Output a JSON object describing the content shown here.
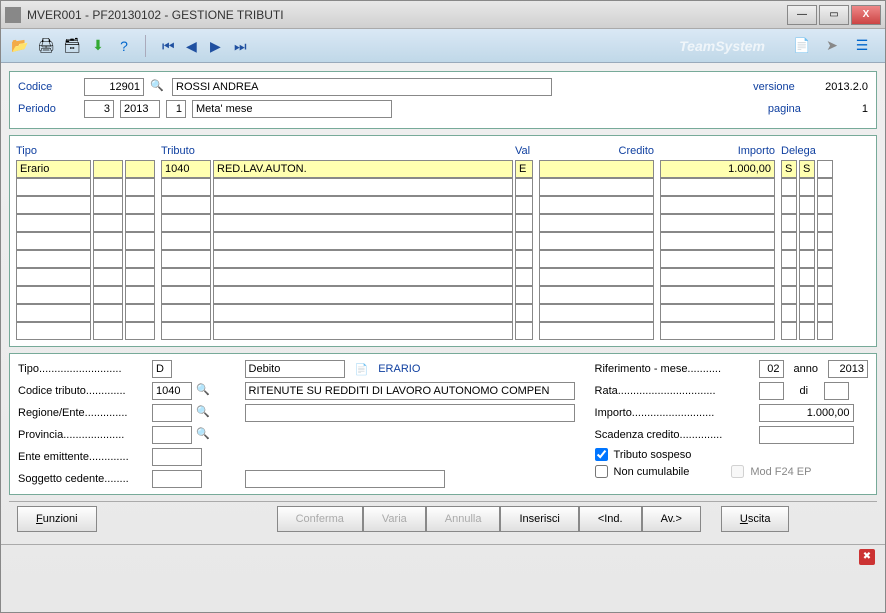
{
  "window": {
    "title": "MVER001  - PF20130102 -  GESTIONE TRIBUTI"
  },
  "brand": "TeamSystem",
  "header": {
    "codice_label": "Codice",
    "codice_value": "12901",
    "codice_name": "ROSSI ANDREA",
    "periodo_label": "Periodo",
    "periodo_month": "3",
    "periodo_year": "2013",
    "periodo_seq": "1",
    "periodo_desc": "Meta' mese",
    "versione_label": "versione",
    "versione_value": "2013.2.0",
    "pagina_label": "pagina",
    "pagina_value": "1"
  },
  "grid": {
    "headers": {
      "tipo": "Tipo",
      "tributo": "Tributo",
      "val": "Val",
      "credito": "Credito",
      "importo": "Importo",
      "delega": "Delega"
    },
    "rows": [
      {
        "tipo": "Erario",
        "tipo2": "",
        "tipo3": "",
        "tributo_code": "1040",
        "tributo_desc": "RED.LAV.AUTON.",
        "val": "E",
        "credito": "",
        "importo": "1.000,00",
        "delega1": "S",
        "delega2": "S",
        "delega3": ""
      },
      {
        "tipo": "",
        "tipo2": "",
        "tipo3": "",
        "tributo_code": "",
        "tributo_desc": "",
        "val": "",
        "credito": "",
        "importo": "",
        "delega1": "",
        "delega2": "",
        "delega3": ""
      },
      {
        "tipo": "",
        "tipo2": "",
        "tipo3": "",
        "tributo_code": "",
        "tributo_desc": "",
        "val": "",
        "credito": "",
        "importo": "",
        "delega1": "",
        "delega2": "",
        "delega3": ""
      },
      {
        "tipo": "",
        "tipo2": "",
        "tipo3": "",
        "tributo_code": "",
        "tributo_desc": "",
        "val": "",
        "credito": "",
        "importo": "",
        "delega1": "",
        "delega2": "",
        "delega3": ""
      },
      {
        "tipo": "",
        "tipo2": "",
        "tipo3": "",
        "tributo_code": "",
        "tributo_desc": "",
        "val": "",
        "credito": "",
        "importo": "",
        "delega1": "",
        "delega2": "",
        "delega3": ""
      },
      {
        "tipo": "",
        "tipo2": "",
        "tipo3": "",
        "tributo_code": "",
        "tributo_desc": "",
        "val": "",
        "credito": "",
        "importo": "",
        "delega1": "",
        "delega2": "",
        "delega3": ""
      },
      {
        "tipo": "",
        "tipo2": "",
        "tipo3": "",
        "tributo_code": "",
        "tributo_desc": "",
        "val": "",
        "credito": "",
        "importo": "",
        "delega1": "",
        "delega2": "",
        "delega3": ""
      },
      {
        "tipo": "",
        "tipo2": "",
        "tipo3": "",
        "tributo_code": "",
        "tributo_desc": "",
        "val": "",
        "credito": "",
        "importo": "",
        "delega1": "",
        "delega2": "",
        "delega3": ""
      },
      {
        "tipo": "",
        "tipo2": "",
        "tipo3": "",
        "tributo_code": "",
        "tributo_desc": "",
        "val": "",
        "credito": "",
        "importo": "",
        "delega1": "",
        "delega2": "",
        "delega3": ""
      },
      {
        "tipo": "",
        "tipo2": "",
        "tipo3": "",
        "tributo_code": "",
        "tributo_desc": "",
        "val": "",
        "credito": "",
        "importo": "",
        "delega1": "",
        "delega2": "",
        "delega3": ""
      }
    ]
  },
  "detail": {
    "tipo_label": "Tipo...........................",
    "tipo_value": "D",
    "tipo_kind": "Debito",
    "tipo_category": "ERARIO",
    "codice_tributo_label": "Codice tributo.............",
    "codice_tributo_value": "1040",
    "codice_tributo_desc": "RITENUTE SU REDDITI DI LAVORO AUTONOMO COMPEN",
    "regione_label": "Regione/Ente..............",
    "regione_value": "",
    "provincia_label": "Provincia....................",
    "provincia_value": "",
    "ente_label": "Ente emittente.............",
    "ente_value": "",
    "soggetto_label": "Soggetto cedente........",
    "soggetto_value": "",
    "riferimento_label": "Riferimento - mese...........",
    "riferimento_mese": "02",
    "riferimento_anno_label": "anno",
    "riferimento_anno": "2013",
    "rata_label": "Rata................................",
    "rata_value": "",
    "rata_di_label": "di",
    "rata_di_value": "",
    "importo_label": "Importo...........................",
    "importo_value": "1.000,00",
    "scadenza_label": "Scadenza credito..............",
    "scadenza_value": "",
    "tributo_sospeso_label": "Tributo sospeso",
    "tributo_sospeso_checked": true,
    "non_cumulabile_label": "Non cumulabile",
    "non_cumulabile_checked": false,
    "mod_f24_label": "Mod F24 EP",
    "mod_f24_checked": false
  },
  "buttons": {
    "funzioni": "Funzioni",
    "conferma": "Conferma",
    "varia": "Varia",
    "annulla": "Annulla",
    "inserisci": "Inserisci",
    "ind": "<Ind.",
    "av": "Av.>",
    "uscita": "Uscita"
  }
}
